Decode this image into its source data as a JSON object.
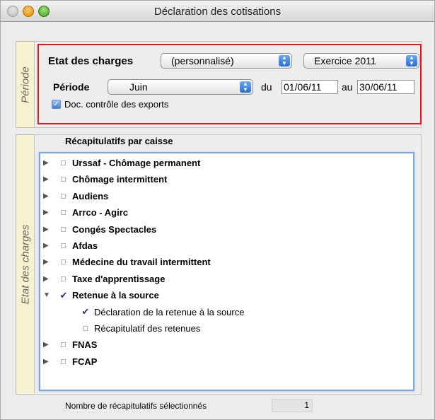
{
  "window": {
    "title": "Déclaration des cotisations"
  },
  "tabs": {
    "periode": "Période",
    "etat": "Etat des charges"
  },
  "periode": {
    "etat_label": "Etat des charges",
    "etat_popup": "(personnalisé)",
    "exercice_popup": "Exercice 2011",
    "periode_label": "Période",
    "mois_popup": "Juin",
    "du_label": "du",
    "du_value": "01/06/11",
    "au_label": "au",
    "au_value": "30/06/11",
    "checkbox_label": "Doc. contrôle des exports",
    "checkbox_checked": true
  },
  "recap": {
    "header": "Récapitulatifs par caisse",
    "items": [
      {
        "label": "Urssaf - Chômage permanent",
        "level": 0,
        "expanded": false,
        "checked": false
      },
      {
        "label": "Chômage intermittent",
        "level": 0,
        "expanded": false,
        "checked": false
      },
      {
        "label": "Audiens",
        "level": 0,
        "expanded": false,
        "checked": false
      },
      {
        "label": "Arrco - Agirc",
        "level": 0,
        "expanded": false,
        "checked": false
      },
      {
        "label": "Congés Spectacles",
        "level": 0,
        "expanded": false,
        "checked": false
      },
      {
        "label": "Afdas",
        "level": 0,
        "expanded": false,
        "checked": false
      },
      {
        "label": "Médecine du travail intermittent",
        "level": 0,
        "expanded": false,
        "checked": false
      },
      {
        "label": "Taxe d'apprentissage",
        "level": 0,
        "expanded": false,
        "checked": false
      },
      {
        "label": "Retenue à la source",
        "level": 0,
        "expanded": true,
        "checked": true
      },
      {
        "label": "Déclaration de la retenue à la source",
        "level": 1,
        "checked": true
      },
      {
        "label": "Récapitulatif des retenues",
        "level": 1,
        "checked": false
      },
      {
        "label": "FNAS",
        "level": 0,
        "expanded": false,
        "checked": false
      },
      {
        "label": "FCAP",
        "level": 0,
        "expanded": false,
        "checked": false
      }
    ]
  },
  "footer": {
    "count_label": "Nombre de récapitulatifs sélectionnés",
    "count_value": "1"
  },
  "icons": {
    "disclosure_closed": "triangle-right-icon",
    "disclosure_open": "triangle-down-icon",
    "check": "checkmark-icon"
  },
  "colors": {
    "highlight_border": "#e01b1b",
    "list_focus": "#7aa7e0",
    "check": "#1f2f9a",
    "sidetab": "#f6f1cf"
  }
}
